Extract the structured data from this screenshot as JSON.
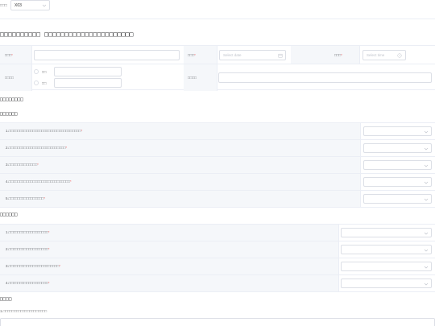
{
  "top": {
    "label": "□□□:",
    "select_value": "X03"
  },
  "main_title": "□□□□□□□□□□ □□□□□□□□□□□□□□□□□□□□□□",
  "form": {
    "field1_label": "□□□",
    "field2_label": "□□□",
    "field2_placeholder": "Select date",
    "field3_label": "□□□",
    "field3_placeholder": "Select time",
    "row2_label": "□□□□",
    "radio1_label": "□□",
    "radio2_label": "□□",
    "row2_label_b": "□□□□",
    "required_mark": "*"
  },
  "section_title": "□□□□□□□□",
  "group1": {
    "title": "□□□□□□",
    "questions": [
      "1.□□□□□□□□□□□□□□□□□□□□□□□□□□□□□□□□□",
      "2.□□□□□□□□□□□□□□□□□□□□□□□□□□",
      "3.□□□□□□□□□□□□□",
      "4.□□□□□□□□□□□□□□□□□□□□□□□□□□□□",
      "5.□□□□□□□□□□□□□□□□"
    ]
  },
  "group2": {
    "title": "□□□□□□",
    "questions": [
      "1.□□□□□□□□□□□□□□□□□□",
      "2.□□□□□□□□□□□□□□□□□□",
      "3.□□□□□□□□□□□□□□□□□□□□□□□",
      "4.□□□□□□□□□□□□□□□□□□"
    ]
  },
  "group3": {
    "title": "□□□□",
    "question": "1.□□□□□□□□□□□□□□□□□□□□"
  },
  "colors": {
    "required": "#f56c6c",
    "border": "#dcdfe6",
    "header_bg": "#f5f7fa"
  },
  "icons": {
    "select": "chevron-down-icon",
    "date": "calendar-icon",
    "time": "clock-icon"
  }
}
